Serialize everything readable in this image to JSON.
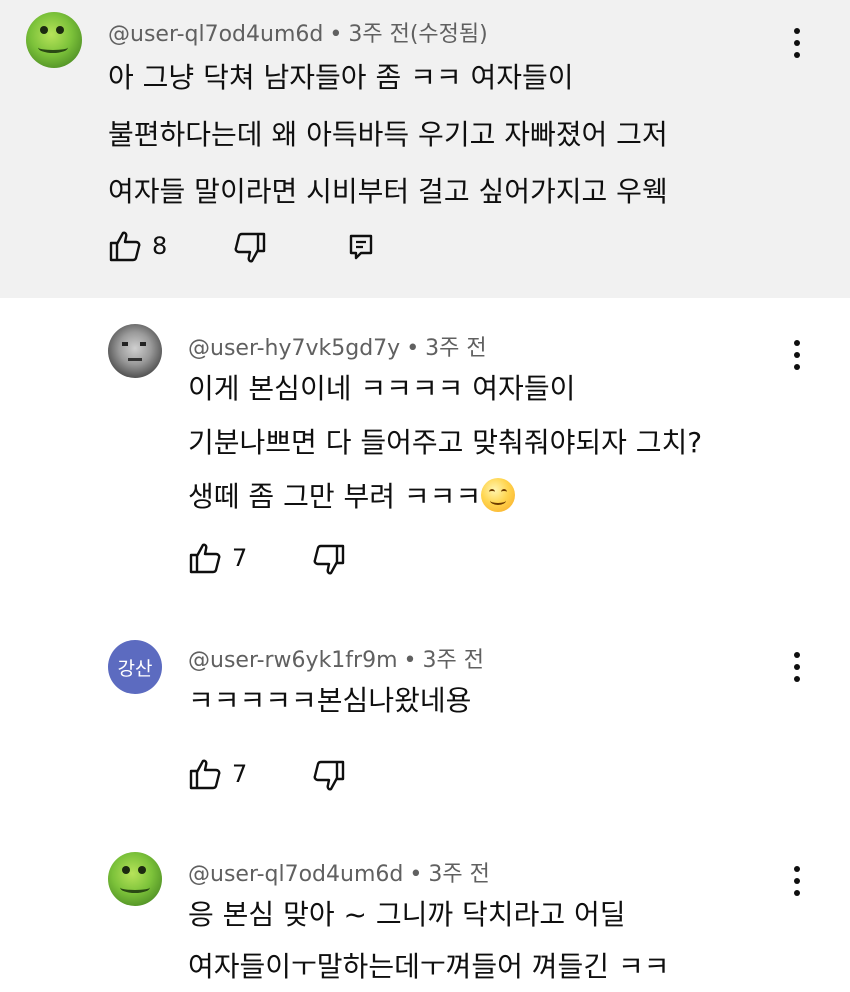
{
  "comments": [
    {
      "username": "@user-ql7od4um6d",
      "time": "3주 전(수정됨)",
      "lines": [
        "아 그냥 닥쳐 남자들아 좀 ㅋㅋ 여자들이",
        "불편하다는데 왜 아득바득 우기고 자빠졌어 그저",
        "여자들 말이라면 시비부터 걸고 싶어가지고 우웩"
      ],
      "likes": "8",
      "avatar_icon": "frog-plush-avatar"
    },
    {
      "username": "@user-hy7vk5gd7y",
      "time": "3주 전",
      "lines": [
        "이게 본심이네 ㅋㅋㅋㅋ 여자들이",
        "기분나쁘면 다 들어주고 맞춰줘야되자 그치?",
        "생떼 좀 그만 부려 ㅋㅋㅋ"
      ],
      "emoji": "smiling-face-emoji",
      "likes": "7",
      "avatar_icon": "face-photo-avatar"
    },
    {
      "username": "@user-rw6yk1fr9m",
      "time": "3주 전",
      "avatar_text": "강산",
      "lines": [
        "ㅋㅋㅋㅋㅋ본심나왔네용"
      ],
      "likes": "7"
    },
    {
      "username": "@user-ql7od4um6d",
      "time": "3주 전",
      "lines": [
        "응 본심 맞아 ~ 그니까 닥치라고 어딜",
        "여자들이ㅜ말하는데ㅜ껴들어 껴들긴 ㅋㅋ"
      ],
      "avatar_icon": "frog-plush-avatar"
    }
  ],
  "separator": "•",
  "colors": {
    "top_comment_bg": "#f1f1f1",
    "meta_text": "#606060",
    "avatar_blue": "#5c6bc0"
  }
}
